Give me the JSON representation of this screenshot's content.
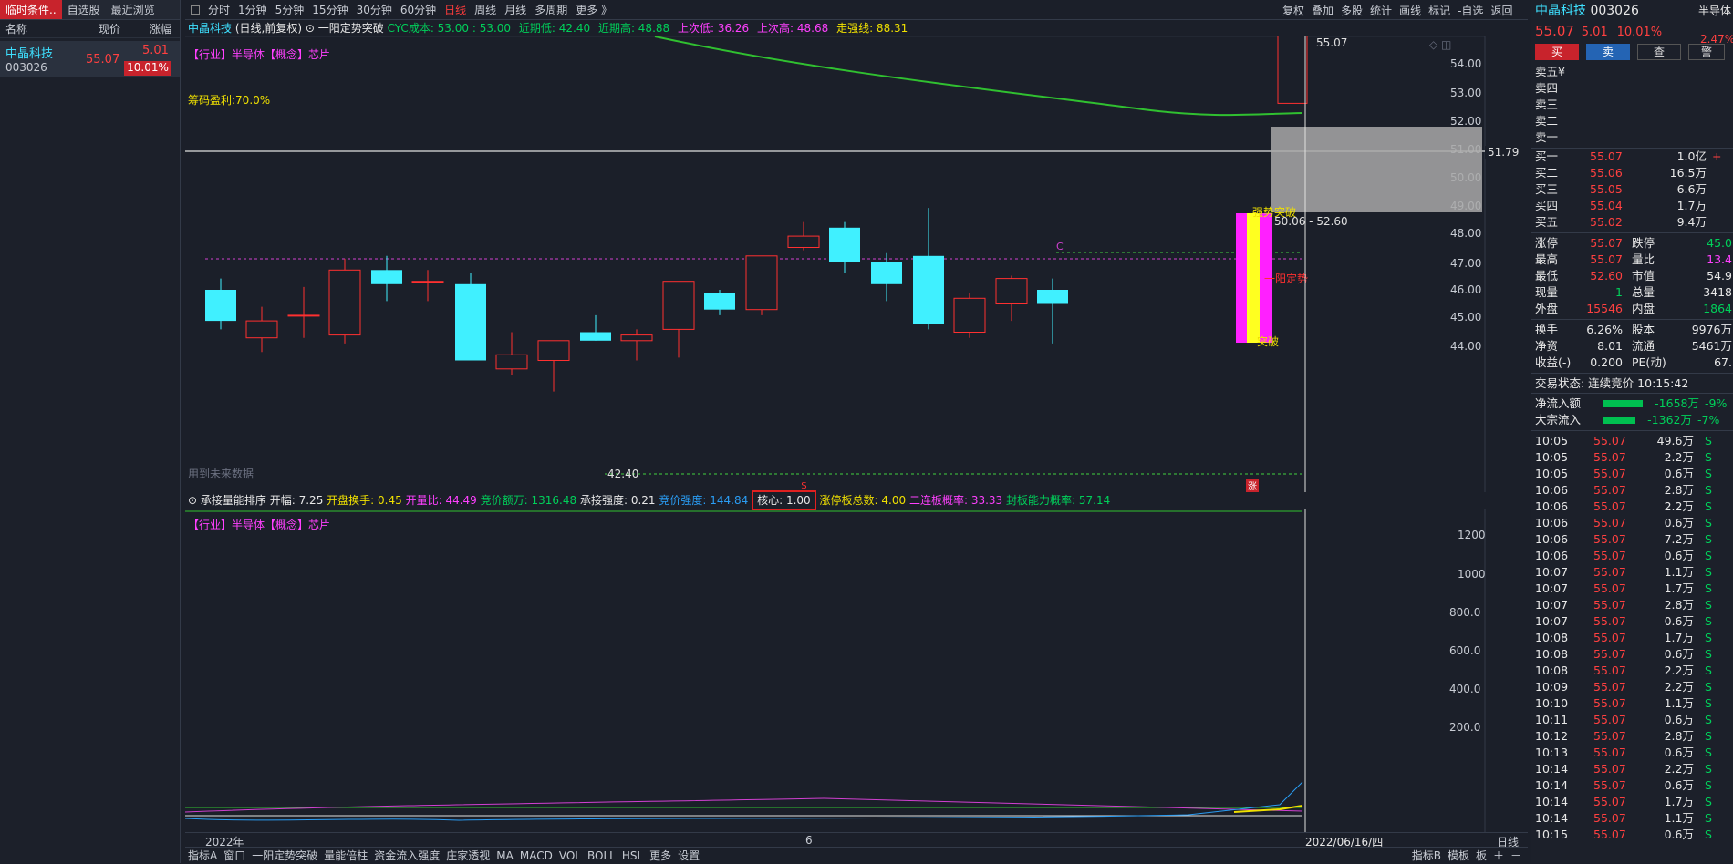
{
  "left_panel": {
    "tabs": [
      "临时条件..",
      "自选股",
      "最近浏览"
    ],
    "headers": {
      "name": "名称",
      "price": "现价",
      "pct": "涨幅"
    },
    "stock": {
      "name": "中晶科技",
      "code": "003026",
      "price": "55.07",
      "change": "5.01",
      "pct": "10.01%"
    }
  },
  "toolbar": {
    "periods": [
      "分时",
      "1分钟",
      "5分钟",
      "15分钟",
      "30分钟",
      "60分钟",
      "日线",
      "周线",
      "月线",
      "多周期",
      "更多 》"
    ],
    "active": "日线",
    "right": [
      "复权",
      "叠加",
      "多股",
      "统计",
      "画线",
      "标记",
      "-自选",
      "返回"
    ]
  },
  "chart_header": {
    "stock": "中晶科技",
    "mode": "(日线,前复权)",
    "indicator": "一阳定势突破",
    "cyc": "CYC成本: 53.00 : 53.00",
    "near_low": "近期低: 42.40",
    "near_high": "近期高: 48.88",
    "prev_low": "上次低: 36.26",
    "prev_high": "上次高: 48.68",
    "strong": "走强线: 88.31"
  },
  "main_chart": {
    "industry_tag": "【行业】半导体【概念】芯片",
    "chip_profit": "筹码盈利:70.0%",
    "future_data": "用到未来数据",
    "price_axis": [
      "54.00",
      "53.00",
      "52.00",
      "51.00",
      "50.00",
      "49.00",
      "48.00",
      "47.00",
      "46.00",
      "45.00",
      "44.00"
    ],
    "last_high_label": "55.07",
    "line_51_79": "51.79",
    "label_50_06": "50.06 - 52.60",
    "low_label": "42.40",
    "tag_c": "C",
    "tag_zhang": "涨",
    "tag_dollar": "$",
    "overlay_yiyang": "一阳定势",
    "overlay_tupo": "突破",
    "overlay_top": "强势突破",
    "candles": [
      {
        "o": 46.0,
        "c": 44.9,
        "h": 46.4,
        "l": 44.6
      },
      {
        "o": 44.3,
        "c": 44.9,
        "h": 45.4,
        "l": 43.8
      },
      {
        "o": 45.1,
        "c": 45.1,
        "h": 46.1,
        "l": 44.3
      },
      {
        "o": 44.4,
        "c": 46.7,
        "h": 47.1,
        "l": 44.1
      },
      {
        "o": 46.7,
        "c": 46.2,
        "h": 47.2,
        "l": 45.6
      },
      {
        "o": 46.3,
        "c": 46.3,
        "h": 46.7,
        "l": 45.6
      },
      {
        "o": 46.2,
        "c": 43.5,
        "h": 46.6,
        "l": 43.5
      },
      {
        "o": 43.2,
        "c": 43.7,
        "h": 44.5,
        "l": 43.0
      },
      {
        "o": 43.5,
        "c": 44.2,
        "h": 44.2,
        "l": 42.4
      },
      {
        "o": 44.5,
        "c": 44.2,
        "h": 45.1,
        "l": 44.2
      },
      {
        "o": 44.2,
        "c": 44.4,
        "h": 44.6,
        "l": 43.5
      },
      {
        "o": 44.6,
        "c": 46.3,
        "h": 46.3,
        "l": 43.6
      },
      {
        "o": 45.9,
        "c": 45.3,
        "h": 46.0,
        "l": 45.1
      },
      {
        "o": 45.3,
        "c": 47.2,
        "h": 47.2,
        "l": 45.1
      },
      {
        "o": 47.5,
        "c": 47.9,
        "h": 48.4,
        "l": 47.4
      },
      {
        "o": 48.2,
        "c": 47.0,
        "h": 48.4,
        "l": 46.6
      },
      {
        "o": 47.0,
        "c": 46.2,
        "h": 47.3,
        "l": 45.6
      },
      {
        "o": 47.2,
        "c": 44.8,
        "h": 48.9,
        "l": 44.6
      },
      {
        "o": 44.5,
        "c": 45.7,
        "h": 45.9,
        "l": 44.3
      },
      {
        "o": 45.5,
        "c": 46.4,
        "h": 46.5,
        "l": 44.9
      },
      {
        "o": 46.0,
        "c": 45.5,
        "h": 46.4,
        "l": 44.1
      },
      {
        "o": 52.6,
        "c": 55.07,
        "h": 55.07,
        "l": 52.6
      }
    ]
  },
  "sub_chart": {
    "title": "承接量能排序",
    "fields": [
      {
        "k": "开幅:",
        "v": "7.25"
      },
      {
        "k": "开盘换手:",
        "v": "0.45"
      },
      {
        "k": "开量比:",
        "v": "44.49"
      },
      {
        "k": "竞价额万:",
        "v": "1316.48"
      },
      {
        "k": "承接强度:",
        "v": "0.21"
      },
      {
        "k": "竞价强度:",
        "v": "144.84"
      },
      {
        "k": "核心:",
        "v": "1.00"
      },
      {
        "k": "涨停板总数:",
        "v": "4.00"
      },
      {
        "k": "二连板概率:",
        "v": "33.33"
      },
      {
        "k": "封板能力概率:",
        "v": "57.14"
      }
    ],
    "industry_tag": "【行业】半导体【概念】芯片",
    "axis": [
      "1200",
      "1000",
      "800.0",
      "600.0",
      "400.0",
      "200.0"
    ]
  },
  "date_axis": {
    "left": "2022年",
    "mid": "6",
    "right": "2022/06/16/四",
    "period": "日线"
  },
  "bottom_tabs": [
    "指标A",
    "窗口",
    "一阳定势突破",
    "量能倍柱",
    "资金流入强度",
    "庄家透视",
    "MA",
    "MACD",
    "VOL",
    "BOLL",
    "HSL",
    "更多",
    "设置"
  ],
  "bottom_right": [
    "指标B",
    "模板",
    "板"
  ],
  "right_panel": {
    "name": "中晶科技",
    "code": "003026",
    "sector": "半导体",
    "price": "55.07",
    "change": "5.01",
    "pct": "10.01%",
    "sector_pct": "2.47%",
    "buttons": [
      "买",
      "卖",
      "查",
      "警"
    ],
    "sell": [
      {
        "k": "卖五",
        "v": "¥"
      },
      {
        "k": "卖四",
        "v": ""
      },
      {
        "k": "卖三",
        "v": ""
      },
      {
        "k": "卖二",
        "v": ""
      },
      {
        "k": "卖一",
        "v": ""
      }
    ],
    "buy": [
      {
        "k": "买一",
        "p": "55.07",
        "v": "1.0亿",
        "x": "+"
      },
      {
        "k": "买二",
        "p": "55.06",
        "v": "16.5万",
        "x": ""
      },
      {
        "k": "买三",
        "p": "55.05",
        "v": "6.6万",
        "x": ""
      },
      {
        "k": "买四",
        "p": "55.04",
        "v": "1.7万",
        "x": ""
      },
      {
        "k": "买五",
        "p": "55.02",
        "v": "9.4万",
        "x": ""
      }
    ],
    "stats": [
      {
        "k1": "涨停",
        "v1": "55.07",
        "k2": "跌停",
        "v2": "45.0"
      },
      {
        "k1": "最高",
        "v1": "55.07",
        "k2": "量比",
        "v2": "13.4"
      },
      {
        "k1": "最低",
        "v1": "52.60",
        "k2": "市值",
        "v2": "54.9"
      },
      {
        "k1": "现量",
        "v1": "1",
        "k2": "总量",
        "v2": "3418"
      },
      {
        "k1": "外盘",
        "v1": "15546",
        "k2": "内盘",
        "v2": "1864"
      }
    ],
    "stats2": [
      {
        "k1": "换手",
        "v1": "6.26%",
        "k2": "股本",
        "v2": "9976万"
      },
      {
        "k1": "净资",
        "v1": "8.01",
        "k2": "流通",
        "v2": "5461万"
      },
      {
        "k1": "收益(-)",
        "v1": "0.200",
        "k2": "PE(动)",
        "v2": "67."
      }
    ],
    "trade_status": "交易状态: 连续竞价 10:15:42",
    "flows": [
      {
        "k": "净流入额",
        "v": "-1658万",
        "p": "-9%"
      },
      {
        "k": "大宗流入",
        "v": "-1362万",
        "p": "-7%"
      }
    ],
    "ticks": [
      [
        "10:05",
        "55.07",
        "49.6万",
        "S"
      ],
      [
        "10:05",
        "55.07",
        "2.2万",
        "S"
      ],
      [
        "10:05",
        "55.07",
        "0.6万",
        "S"
      ],
      [
        "10:06",
        "55.07",
        "2.8万",
        "S"
      ],
      [
        "10:06",
        "55.07",
        "2.2万",
        "S"
      ],
      [
        "10:06",
        "55.07",
        "0.6万",
        "S"
      ],
      [
        "10:06",
        "55.07",
        "7.2万",
        "S"
      ],
      [
        "10:06",
        "55.07",
        "0.6万",
        "S"
      ],
      [
        "10:07",
        "55.07",
        "1.1万",
        "S"
      ],
      [
        "10:07",
        "55.07",
        "1.7万",
        "S"
      ],
      [
        "10:07",
        "55.07",
        "2.8万",
        "S"
      ],
      [
        "10:07",
        "55.07",
        "0.6万",
        "S"
      ],
      [
        "10:08",
        "55.07",
        "1.7万",
        "S"
      ],
      [
        "10:08",
        "55.07",
        "0.6万",
        "S"
      ],
      [
        "10:08",
        "55.07",
        "2.2万",
        "S"
      ],
      [
        "10:09",
        "55.07",
        "2.2万",
        "S"
      ],
      [
        "10:10",
        "55.07",
        "1.1万",
        "S"
      ],
      [
        "10:11",
        "55.07",
        "0.6万",
        "S"
      ],
      [
        "10:12",
        "55.07",
        "2.8万",
        "S"
      ],
      [
        "10:13",
        "55.07",
        "0.6万",
        "S"
      ],
      [
        "10:14",
        "55.07",
        "2.2万",
        "S"
      ],
      [
        "10:14",
        "55.07",
        "0.6万",
        "S"
      ],
      [
        "10:14",
        "55.07",
        "1.7万",
        "S"
      ],
      [
        "10:14",
        "55.07",
        "1.1万",
        "S"
      ],
      [
        "10:15",
        "55.07",
        "0.6万",
        "S"
      ]
    ]
  }
}
